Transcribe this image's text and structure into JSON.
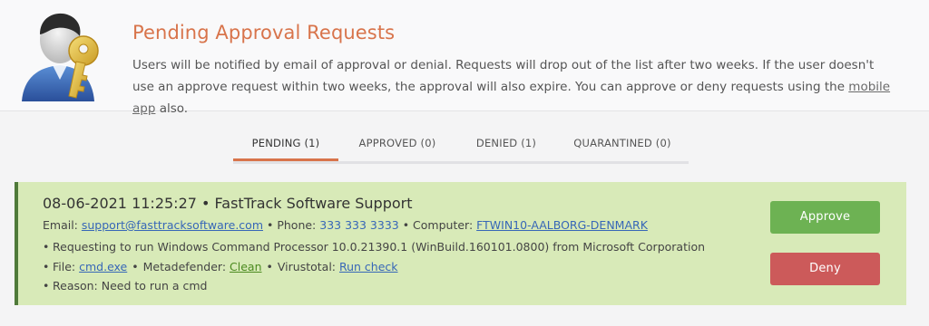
{
  "header": {
    "title": "Pending Approval Requests",
    "description_part1": "Users will be notified by email of approval or denial. Requests will drop out of the list after two weeks. If the user doesn't use an approve request within two weeks, the approval will also expire. You can approve or deny requests using the ",
    "mobile_app_link": "mobile app",
    "description_part2": " also."
  },
  "tabs": [
    {
      "label": "PENDING (1)",
      "active": true
    },
    {
      "label": "APPROVED (0)",
      "active": false
    },
    {
      "label": "DENIED (1)",
      "active": false
    },
    {
      "label": "QUARANTINED (0)",
      "active": false
    }
  ],
  "request": {
    "title": "08-06-2021 11:25:27 • FastTrack Software Support",
    "email_label": "Email: ",
    "email": "support@fasttracksoftware.com",
    "phone_label": " • Phone: ",
    "phone": "333 333 3333",
    "computer_label": " • Computer: ",
    "computer": "FTWIN10-AALBORG-DENMARK",
    "requesting": "Requesting to run Windows Command Processor 10.0.21390.1 (WinBuild.160101.0800) from Microsoft Corporation",
    "file_label": "File: ",
    "file": "cmd.exe",
    "metadefender_label": "Metadefender: ",
    "metadefender": "Clean",
    "virustotal_label": "Virustotal: ",
    "virustotal": "Run check",
    "reason": "Reason: Need to run a cmd",
    "bullet": "•",
    "dot_sep": "•"
  },
  "buttons": {
    "approve": "Approve",
    "deny": "Deny"
  },
  "colors": {
    "accent": "#d8744b",
    "card_bg": "#d8eab8",
    "approve": "#6db253",
    "deny": "#cc5a5a",
    "link": "#3767b7"
  },
  "icons": {
    "hero": "user-with-key-icon"
  }
}
